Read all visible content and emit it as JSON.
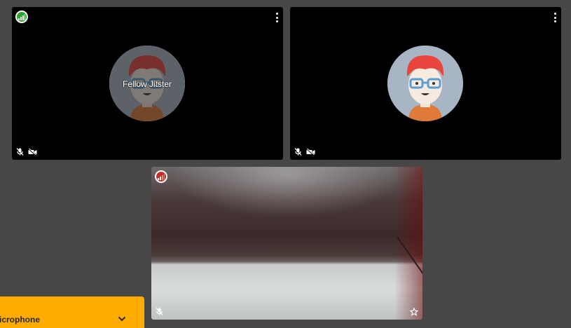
{
  "participants": [
    {
      "display_name": "Fellow Jitster",
      "connection": "good",
      "audio_muted": true,
      "video_muted": true
    },
    {
      "display_name": "",
      "connection": "none",
      "audio_muted": true,
      "video_muted": true
    },
    {
      "display_name": "",
      "connection": "poor",
      "audio_muted": true,
      "video_muted": false,
      "local": true
    }
  ],
  "colors": {
    "background": "#474747",
    "tile": "#000000",
    "connection_good": "#2fa32f",
    "connection_poor": "#c0312b",
    "notification": "#ffab00"
  },
  "icons": {
    "connection": "signal-bars-icon",
    "more": "more-vertical-icon",
    "mic_muted": "mic-muted-icon",
    "video_muted": "video-muted-icon",
    "star": "star-icon",
    "chevron": "chevron-down-icon"
  },
  "notification": {
    "title": "icrophone"
  }
}
